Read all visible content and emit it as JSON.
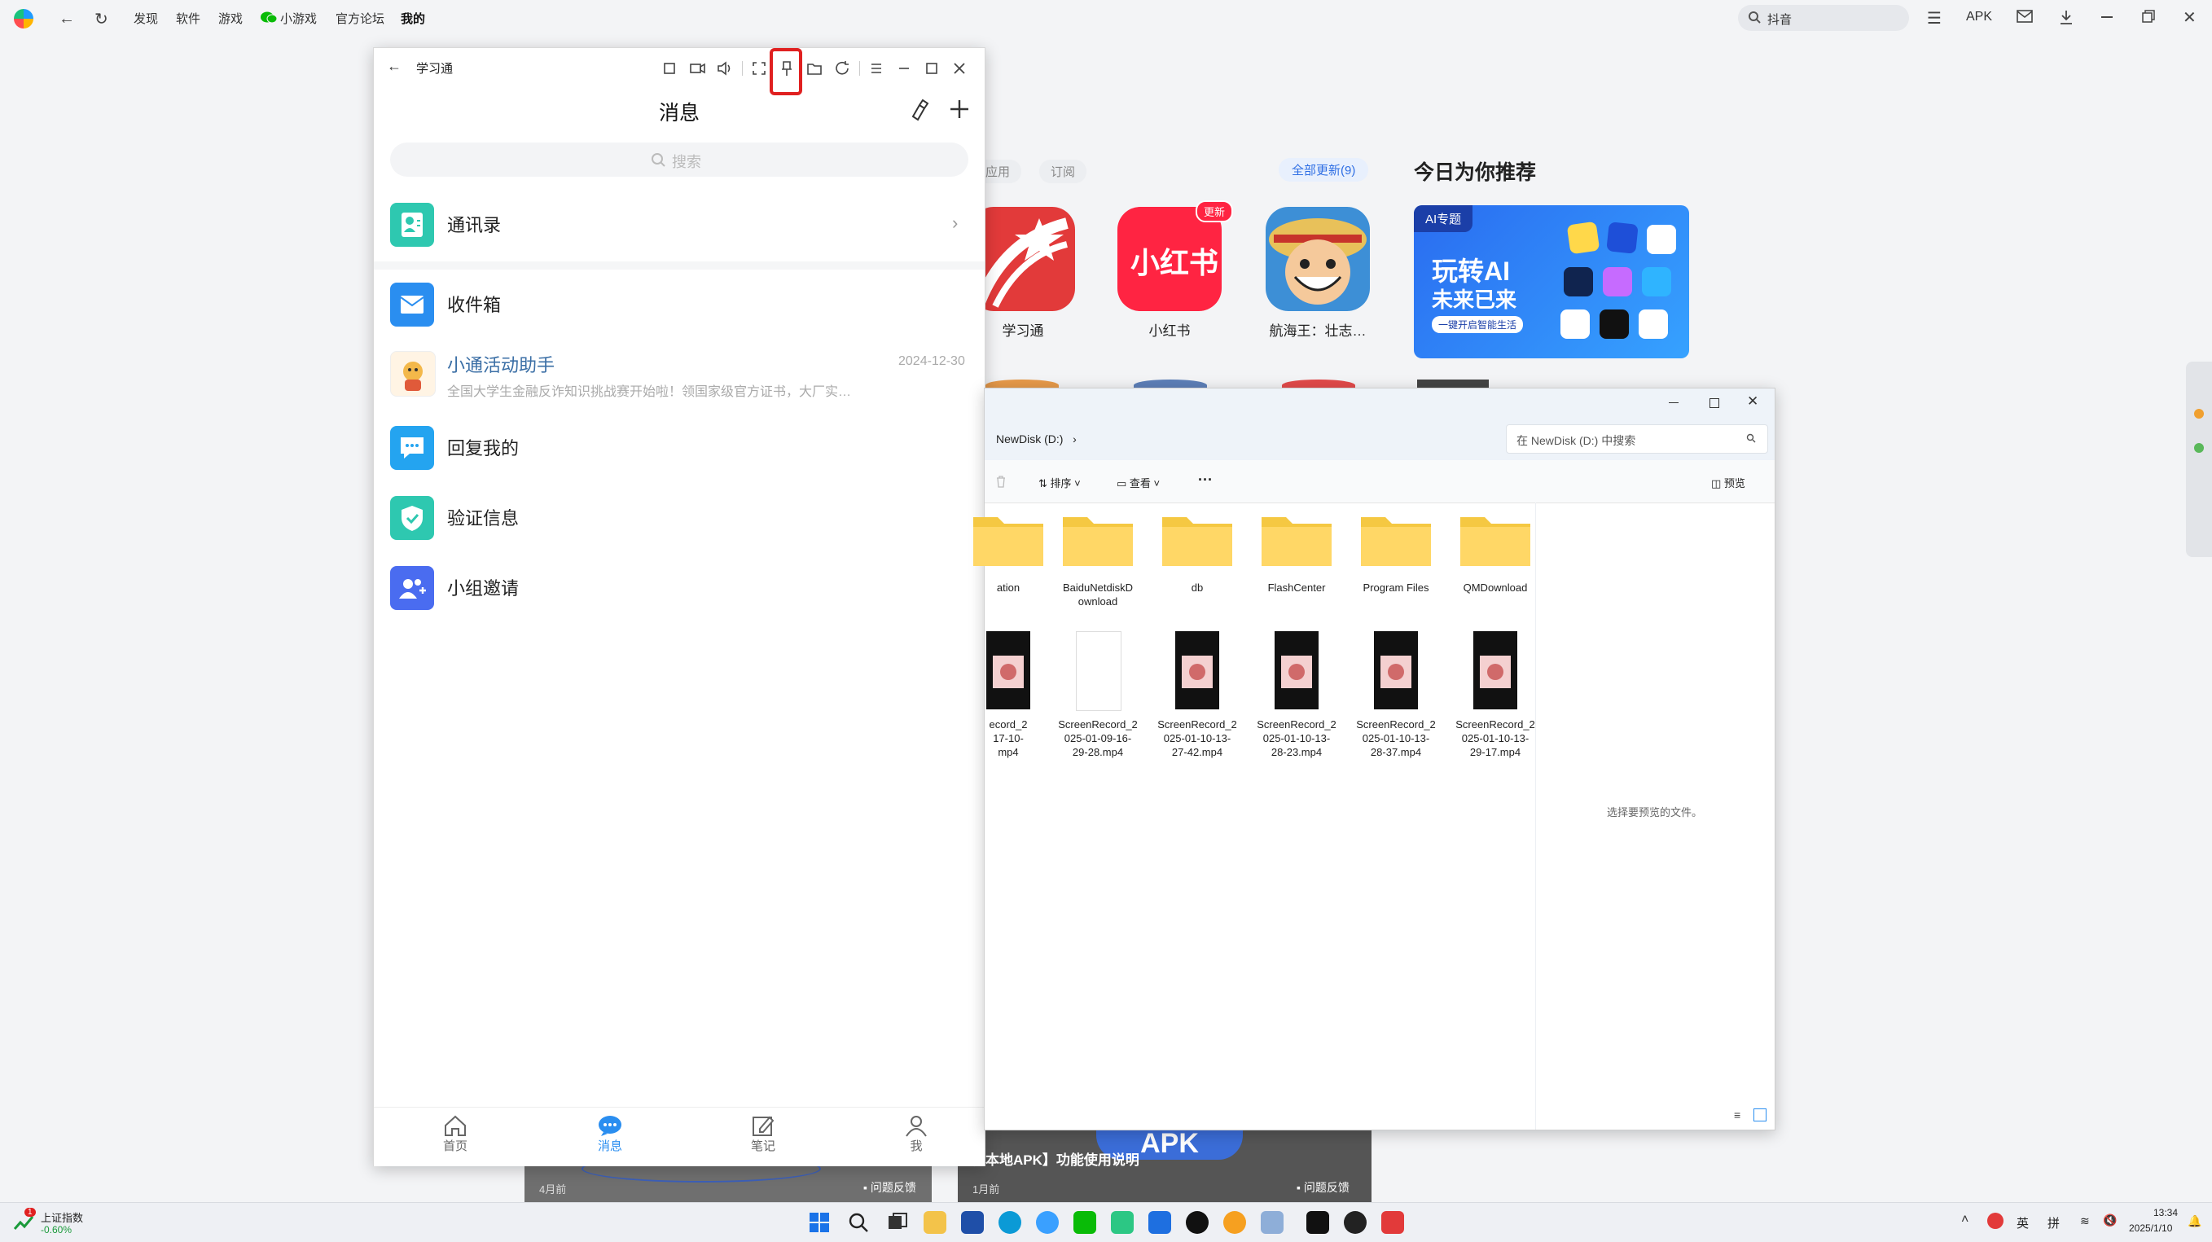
{
  "topbar": {
    "nav": [
      "发现",
      "软件",
      "游戏",
      "小游戏",
      "官方论坛",
      "我的"
    ],
    "search_placeholder": "抖音",
    "apk_label": "APK"
  },
  "store": {
    "tabs": [
      "应用",
      "订阅"
    ],
    "update_all": "全部更新(9)",
    "recommend_title": "今日为你推荐",
    "apps": [
      {
        "name": "学习通",
        "color": "#e23a3a"
      },
      {
        "name": "小红书",
        "color": "#ff2442",
        "badge": "更新"
      },
      {
        "name": "航海王：壮志…",
        "color": "#3d8fd6"
      }
    ],
    "banner": {
      "tag": "AI专题",
      "line1": "玩转AI",
      "line2": "未来已来",
      "sub": "一键开启智能生活"
    },
    "cards": [
      {
        "time": "4月前",
        "feedback": "问题反馈"
      },
      {
        "time": "1月前",
        "feedback": "问题反馈",
        "caption": "安装本地APK】功能使用说明",
        "tag": "APK"
      }
    ]
  },
  "phone": {
    "title": "学习通",
    "header": "消息",
    "search_placeholder": "搜索",
    "contacts": "通讯录",
    "inbox": "收件箱",
    "assistant": {
      "title": "小通活动助手",
      "date": "2024-12-30",
      "preview": "全国大学生金融反诈知识挑战赛开始啦！领国家级官方证书，大厂实…"
    },
    "reply": "回复我的",
    "verify": "验证信息",
    "group": "小组邀请",
    "bottom_nav": [
      "首页",
      "消息",
      "笔记",
      "我"
    ]
  },
  "explorer": {
    "path": "NewDisk (D:)",
    "search_placeholder": "在 NewDisk (D:) 中搜索",
    "sort_label": "排序",
    "view_label": "查看",
    "more_label": "···",
    "preview_label": "预览",
    "preview_hint": "选择要预览的文件。",
    "folders": [
      {
        "name": "ation"
      },
      {
        "name": "BaiduNetdiskD\nownload"
      },
      {
        "name": "db"
      },
      {
        "name": "FlashCenter"
      },
      {
        "name": "Program Files"
      },
      {
        "name": "QMDownload"
      }
    ],
    "files": [
      {
        "name": "ecord_2\n17-10-\nmp4"
      },
      {
        "name": "ScreenRecord_2\n025-01-09-16-\n29-28.mp4"
      },
      {
        "name": "ScreenRecord_2\n025-01-10-13-\n27-42.mp4"
      },
      {
        "name": "ScreenRecord_2\n025-01-10-13-\n28-23.mp4"
      },
      {
        "name": "ScreenRecord_2\n025-01-10-13-\n28-37.mp4"
      },
      {
        "name": "ScreenRecord_2\n025-01-10-13-\n29-17.mp4"
      }
    ]
  },
  "taskbar": {
    "stock_name": "上证指数",
    "stock_change": "-0.60%",
    "stock_badge": "1",
    "ime1": "英",
    "ime2": "拼",
    "time": "13:34",
    "date": "2025/1/10"
  }
}
